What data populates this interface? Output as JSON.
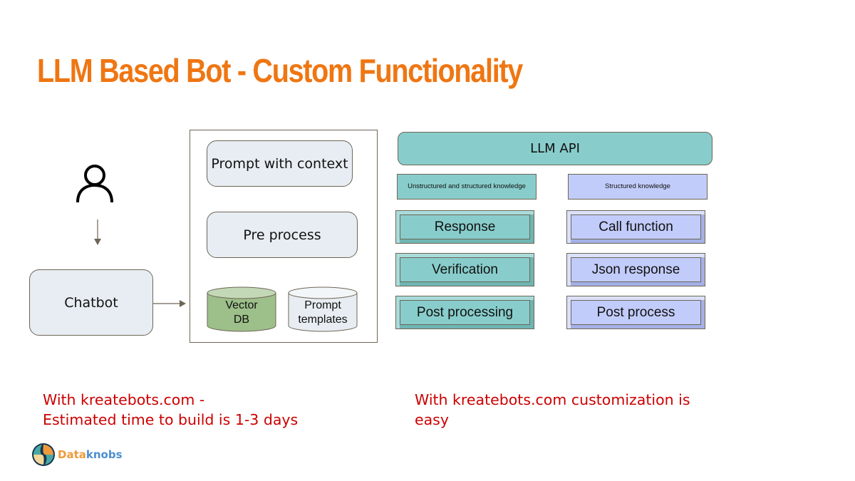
{
  "title": "LLM Based Bot - Custom Functionality",
  "diagram": {
    "user_icon": "person-icon",
    "chatbot": "Chatbot",
    "pipeline": {
      "prompt_with_context": "Prompt with context",
      "pre_process": "Pre process",
      "vector_db": {
        "line1": "Vector",
        "line2": "DB",
        "color": "#9dbf8a"
      },
      "prompt_templates": {
        "line1": "Prompt",
        "line2": "templates",
        "color": "#e7edf2"
      }
    },
    "llm_api": "LLM API",
    "left_column": {
      "label": "Unstructured and structured knowledge",
      "color": "#88cdcb",
      "steps": [
        "Response",
        "Verification",
        "Post processing"
      ]
    },
    "right_column": {
      "label": "Structured knowledge",
      "color": "#c2ccfa",
      "steps": [
        "Call function",
        "Json response",
        "Post process"
      ]
    }
  },
  "notes": {
    "left_line1": "With kreatebots.com -",
    "left_line2": "Estimated time to build is 1-3 days",
    "right_line1": "With kreatebots.com customization is",
    "right_line2": "easy"
  },
  "logo": {
    "part1": "Data",
    "part2": "knobs"
  }
}
